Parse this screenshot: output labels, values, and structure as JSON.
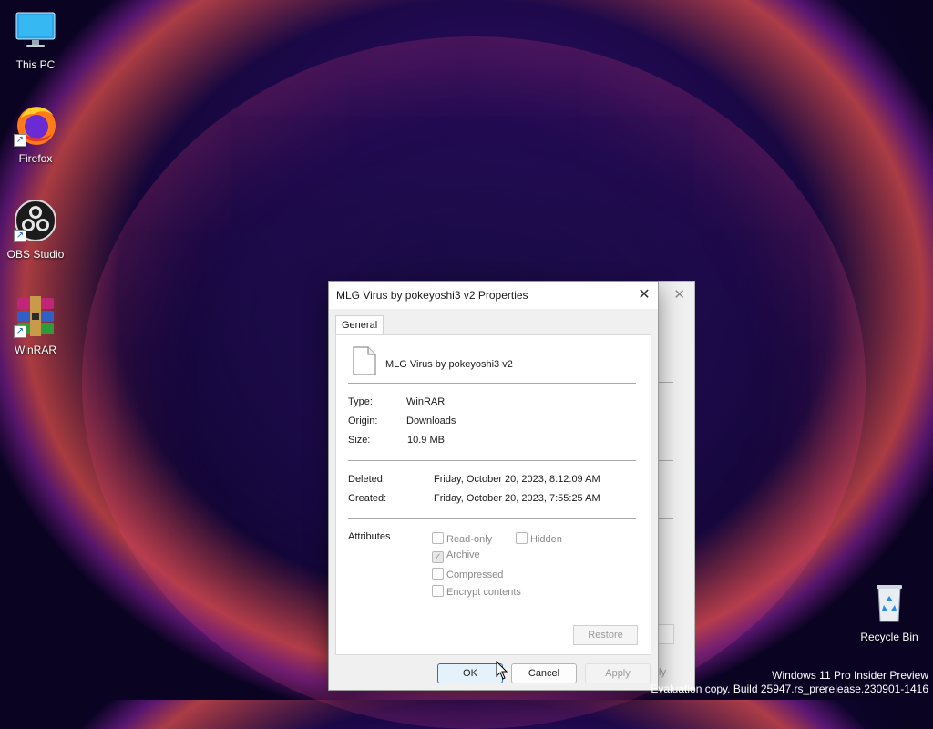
{
  "desktop": {
    "icons": [
      {
        "label": "This PC",
        "icon": "monitor-icon"
      },
      {
        "label": "Firefox",
        "icon": "firefox-icon"
      },
      {
        "label": "OBS Studio",
        "icon": "obs-icon"
      },
      {
        "label": "WinRAR",
        "icon": "winrar-icon"
      }
    ],
    "recycle_bin": {
      "label": "Recycle Bin",
      "icon": "recycle-bin-icon"
    }
  },
  "dialog": {
    "title": "MLG Virus by pokeyoshi3 v2 Properties",
    "tab": "General",
    "file_name": "MLG Virus by pokeyoshi3 v2",
    "fields": {
      "type_label": "Type:",
      "type_value": "WinRAR",
      "origin_label": "Origin:",
      "origin_value": "Downloads",
      "size_label": "Size:",
      "size_value": "10.9 MB",
      "deleted_label": "Deleted:",
      "deleted_value": "Friday, October 20, 2023, 8:12:09 AM",
      "created_label": "Created:",
      "created_value": "Friday, October 20, 2023, 7:55:25 AM"
    },
    "attributes": {
      "label": "Attributes",
      "read_only": {
        "label": "Read-only",
        "checked": false
      },
      "hidden": {
        "label": "Hidden",
        "checked": false
      },
      "archive": {
        "label": "Archive",
        "checked": true
      },
      "compressed": {
        "label": "Compressed",
        "checked": false
      },
      "encrypt": {
        "label": "Encrypt contents",
        "checked": false
      }
    },
    "restore_label": "Restore",
    "buttons": {
      "ok": "OK",
      "cancel": "Cancel",
      "apply": "Apply"
    }
  },
  "back_window": {
    "apply_partial": "ly"
  },
  "watermark": {
    "line1": "Windows 11 Pro Insider Preview",
    "line2": "Evaluation copy. Build 25947.rs_prerelease.230901-1416"
  },
  "colors": {
    "accent": "#2a6bd3",
    "wallpaper_dark": "#14063a",
    "wallpaper_glow": "#ff4aa0"
  }
}
